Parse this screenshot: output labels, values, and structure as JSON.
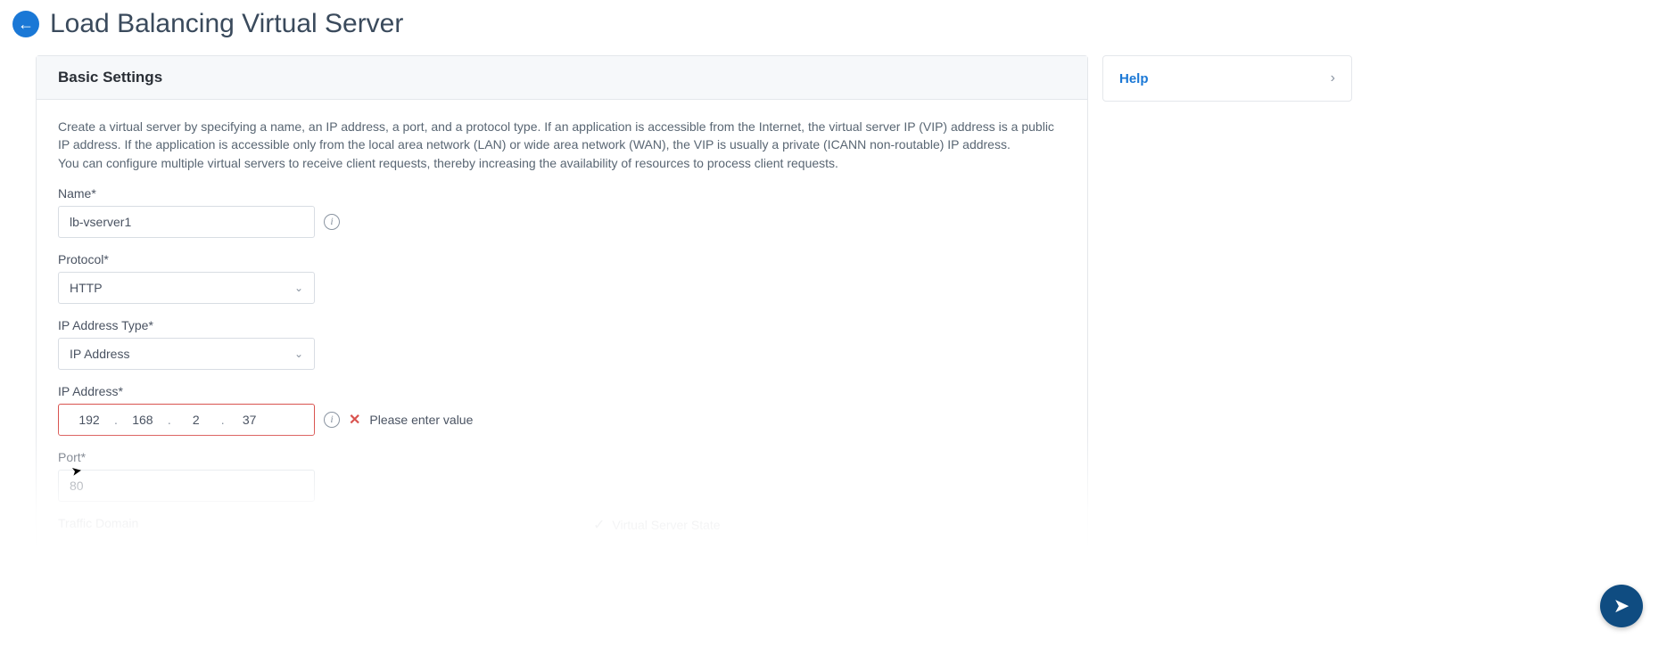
{
  "header": {
    "title": "Load Balancing Virtual Server"
  },
  "card": {
    "title": "Basic Settings",
    "description_line1": "Create a virtual server by specifying a name, an IP address, a port, and a protocol type. If an application is accessible from the Internet, the virtual server IP (VIP) address is a public IP address. If the application is accessible only from the local area network (LAN) or wide area network (WAN), the VIP is usually a private (ICANN non-routable) IP address.",
    "description_line2": "You can configure multiple virtual servers to receive client requests, thereby increasing the availability of resources to process client requests."
  },
  "fields": {
    "name": {
      "label": "Name*",
      "value": "lb-vserver1"
    },
    "protocol": {
      "label": "Protocol*",
      "value": "HTTP"
    },
    "ip_type": {
      "label": "IP Address Type*",
      "value": "IP Address"
    },
    "ip_address": {
      "label": "IP Address*",
      "oct1": "192",
      "oct2": "168",
      "oct3": "2",
      "oct4": "37",
      "error": "Please enter value"
    },
    "port": {
      "label": "Port*",
      "value": "80"
    },
    "traffic_domain": {
      "label": "Traffic Domain"
    },
    "vserver_state": {
      "label": "Virtual Server State"
    }
  },
  "sidebar": {
    "help_label": "Help"
  }
}
